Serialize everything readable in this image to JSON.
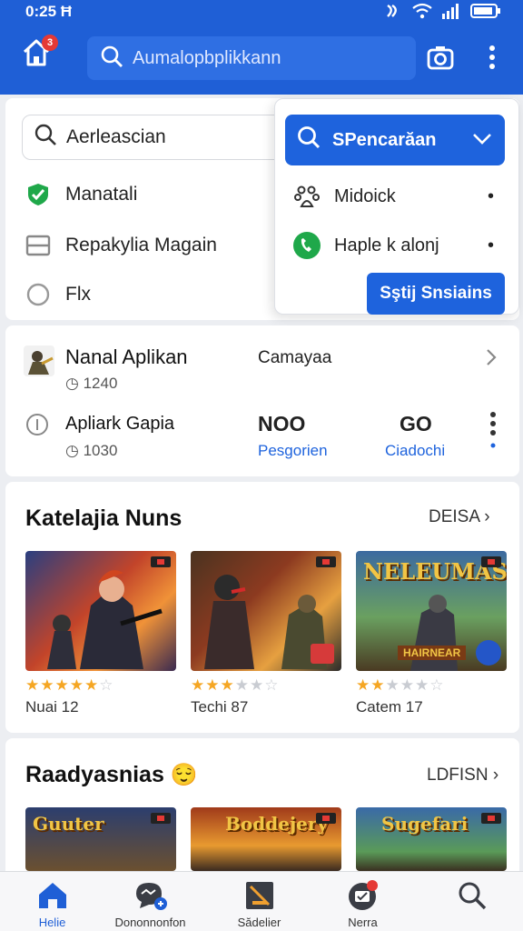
{
  "colors": {
    "primary": "#1f5fd6",
    "accent": "#1e63dd",
    "star": "#f5a623",
    "badge": "#e53935",
    "success": "#1fa84a"
  },
  "status_bar": {
    "time": "0:25 Ħ",
    "icons": [
      "nfc-icon",
      "wifi-icon",
      "signal-icon",
      "battery-icon"
    ]
  },
  "app_bar": {
    "notification_count": "3",
    "search_placeholder": "Aumalopbplikkann"
  },
  "search_panel": {
    "query": "Aerleascian",
    "options": [
      {
        "icon": "check-shield-icon",
        "label": "Manatali"
      },
      {
        "icon": "window-icon",
        "label": "Repakylia Magain"
      },
      {
        "icon": "radio-icon",
        "label": "Flx"
      }
    ]
  },
  "dropdown": {
    "header": "SPencarăan",
    "items": [
      {
        "icon": "paw-icon",
        "label": "Midoick"
      },
      {
        "icon": "phone-icon",
        "label": "Haple k alonj"
      }
    ],
    "action_label": "Sştij Snsiains"
  },
  "app_info": {
    "row1": {
      "name": "Nanal Aplikan",
      "sub": "1240",
      "category": "Camayaa"
    },
    "row2": {
      "name": "Apliark Gapia",
      "sub": "1030",
      "stat1_value": "NOO",
      "stat1_label": "Pesgorien",
      "stat2_value": "GO",
      "stat2_label": "Ciadochi"
    }
  },
  "section1": {
    "title": "Katelajia Nuns",
    "link": "DEISA",
    "cards": [
      {
        "rating": 4.5,
        "label": "Nuai 12"
      },
      {
        "rating": 2.5,
        "label": "Techi 87"
      },
      {
        "rating": 2,
        "label": "Catem 17",
        "title": "NELEUMAS",
        "banner": "HAIRNEAR"
      }
    ]
  },
  "section2": {
    "title": "Raadyasnias",
    "emoji": "😌",
    "link": "LDFISN",
    "cards": [
      {
        "title": "Guuter"
      },
      {
        "title": "Boddejery"
      },
      {
        "title": "Sugefari"
      }
    ]
  },
  "bottom_nav": [
    {
      "icon": "home-icon",
      "label": "Helie",
      "active": true
    },
    {
      "icon": "chat-icon",
      "label": "Dononnonfon",
      "active": false
    },
    {
      "icon": "tablet-icon",
      "label": "Sădelier",
      "active": false
    },
    {
      "icon": "store-icon",
      "label": "Nerra",
      "active": false
    },
    {
      "icon": "search-icon",
      "label": "",
      "active": false
    }
  ]
}
